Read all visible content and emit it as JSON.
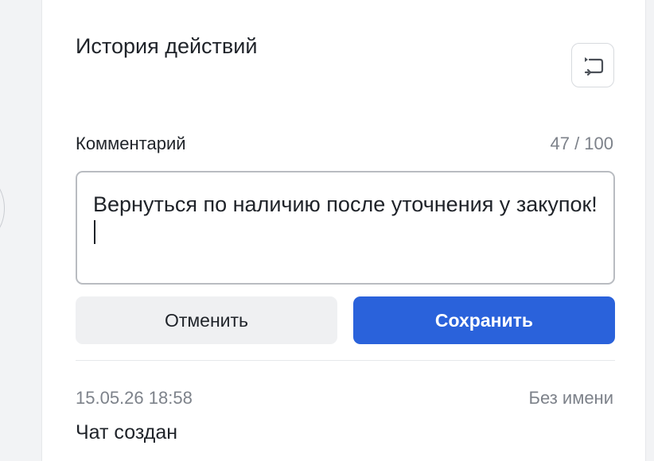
{
  "history": {
    "title": "История действий",
    "toggle_icon": "history-toggle-icon"
  },
  "comment": {
    "label": "Комментарий",
    "counter": "47 / 100",
    "value": "Вернуться по наличию после уточнения у закупок!"
  },
  "actions": {
    "cancel_label": "Отменить",
    "save_label": "Сохранить"
  },
  "entries": [
    {
      "timestamp": "15.05.26 18:58",
      "author": "Без имени",
      "text": "Чат создан"
    }
  ],
  "colors": {
    "accent": "#2a62db",
    "cancel_bg": "#eff0f2",
    "muted_text": "#7d828a",
    "border": "#b9bcc1"
  }
}
